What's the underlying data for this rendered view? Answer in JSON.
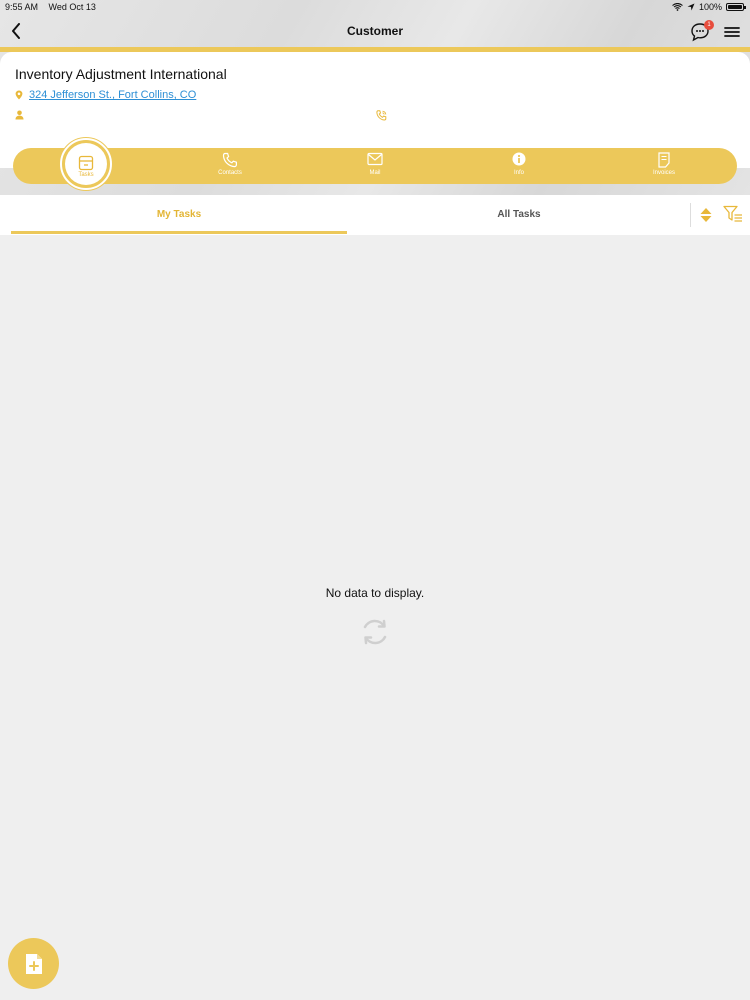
{
  "status": {
    "time": "9:55 AM",
    "date": "Wed Oct 13",
    "battery": "100%"
  },
  "nav": {
    "title": "Customer",
    "chat_badge": "1"
  },
  "customer": {
    "name": "Inventory Adjustment International",
    "address": "324 Jefferson St., Fort Collins, CO"
  },
  "segments": [
    {
      "label": "Tasks",
      "icon": "tasks-icon"
    },
    {
      "label": "Contacts",
      "icon": "phone-icon"
    },
    {
      "label": "Mail",
      "icon": "mail-icon"
    },
    {
      "label": "Info",
      "icon": "info-icon"
    },
    {
      "label": "Invoices",
      "icon": "invoice-icon"
    }
  ],
  "tabs": {
    "my_tasks": "My Tasks",
    "all_tasks": "All Tasks"
  },
  "empty": {
    "message": "No data to display."
  },
  "colors": {
    "accent": "#ecc85a",
    "link": "#2d8fd5",
    "background": "#efefef"
  }
}
